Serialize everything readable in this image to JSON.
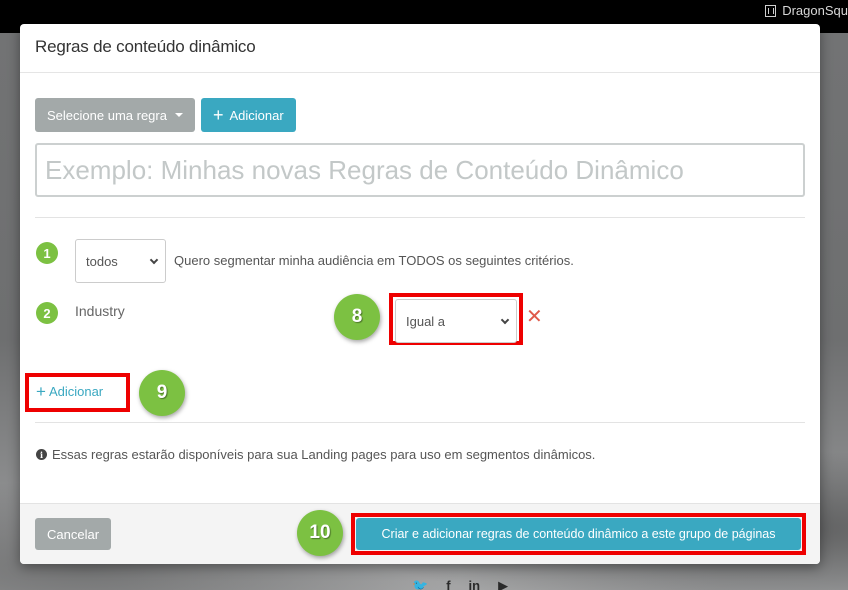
{
  "topbar": {
    "org_icon": "building-icon",
    "org_name": "DragonSqu"
  },
  "modal": {
    "title": "Regras de conteúdo dinâmico",
    "toolbar": {
      "select_rule_label": "Selecione uma regra",
      "add_label": "Adicionar"
    },
    "name_input": {
      "value": "",
      "placeholder": "Exemplo: Minhas novas Regras de Conteúdo Dinâmico"
    },
    "criteria": {
      "step1": {
        "number": "1",
        "match_select_value": "todos",
        "description": "Quero segmentar minha audiência em TODOS os seguintes critérios."
      },
      "step2": {
        "number": "2",
        "field": "Industry",
        "operator_select_value": "Igual a",
        "remove_icon": "close-icon"
      }
    },
    "add_criteria_label": "Adicionar",
    "info_note": "Essas regras estarão disponíveis para sua Landing pages para uso em segmentos dinâmicos.",
    "footer": {
      "cancel_label": "Cancelar",
      "submit_label": "Criar e adicionar regras de conteúdo dinâmico a este grupo de páginas"
    }
  },
  "annotations": {
    "callout_8": "8",
    "callout_9": "9",
    "callout_10": "10"
  },
  "background": {
    "social_icons": [
      "twitter-icon",
      "facebook-icon",
      "linkedin-icon",
      "youtube-icon"
    ],
    "social_glyphs": [
      "🐦",
      "f",
      "in",
      "▶"
    ]
  },
  "colors": {
    "accent_teal": "#3aa8c1",
    "step_green": "#7cc142",
    "highlight_red": "#ee0000",
    "remove_red": "#e05a4a",
    "button_grey": "#a3a9a9"
  }
}
